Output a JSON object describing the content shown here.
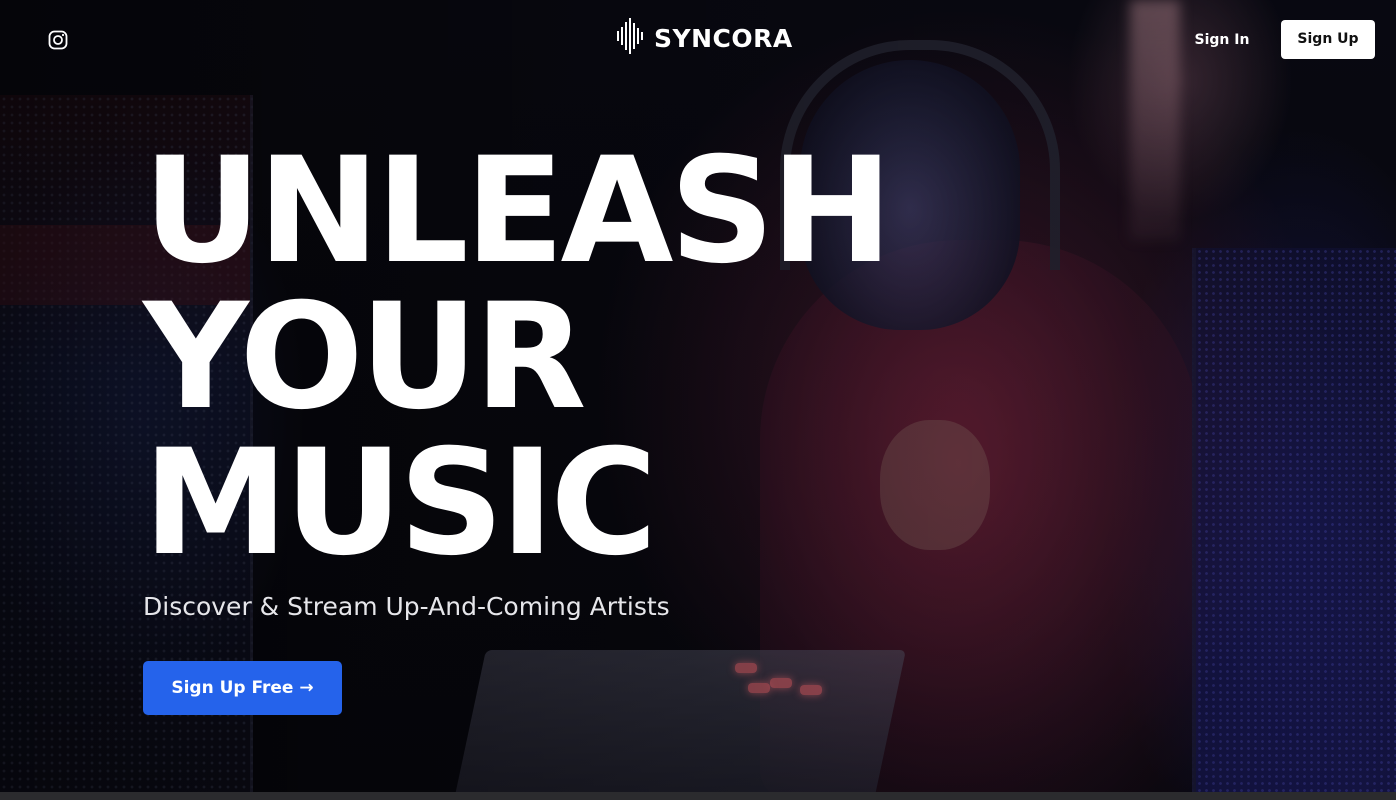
{
  "header": {
    "social_icon": "instagram-icon",
    "brand": {
      "logo_icon": "soundwave-icon",
      "name": "SYNCORA"
    },
    "sign_in_label": "Sign In",
    "sign_up_label": "Sign Up"
  },
  "hero": {
    "headline_lines": [
      "UNLEASH",
      "YOUR",
      "MUSIC"
    ],
    "subtitle": "Discover & Stream Up-And-Coming Artists",
    "cta_label": "Sign Up Free →"
  },
  "colors": {
    "accent": "#2563eb",
    "text": "#ffffff",
    "background": "#07070e"
  }
}
